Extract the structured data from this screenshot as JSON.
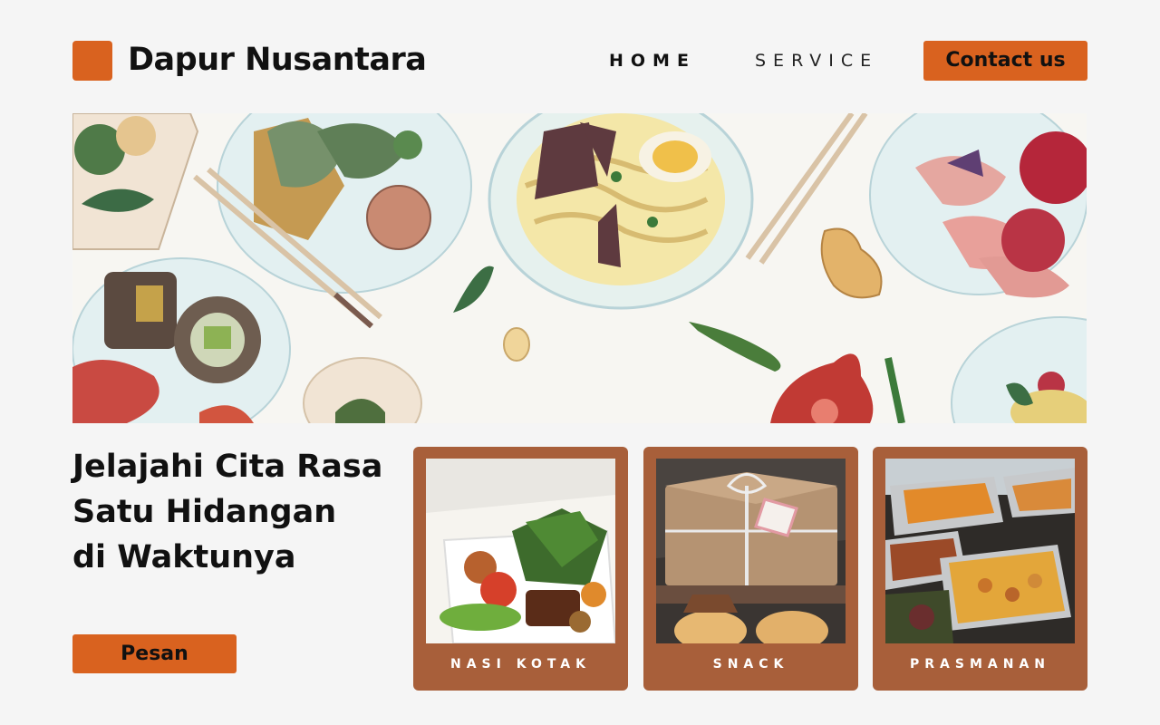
{
  "header": {
    "brand": "Dapur Nusantara",
    "nav": {
      "home": "HOME",
      "service": "SERVICE"
    },
    "contact_label": "Contact us"
  },
  "hero": {
    "headline_lines": [
      "Jelajahi Cita Rasa",
      "Satu Hidangan",
      "di Waktunya"
    ],
    "cta_label": "Pesan"
  },
  "cards": [
    {
      "label": "NASI KOTAK"
    },
    {
      "label": "SNACK"
    },
    {
      "label": "PRASMANAN"
    }
  ],
  "colors": {
    "accent": "#d9621f",
    "card_bg": "#a85f3a",
    "page_bg": "#f5f5f5"
  }
}
